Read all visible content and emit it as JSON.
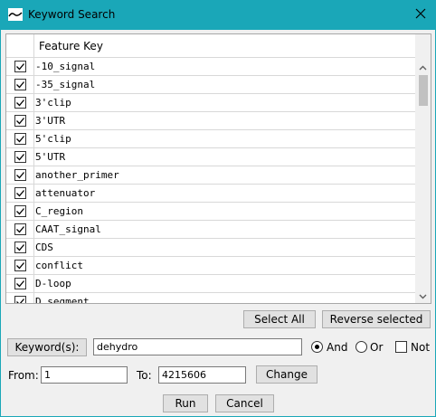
{
  "window": {
    "title": "Keyword Search",
    "accent_color": "#1aa7b8",
    "close_icon": "close-icon"
  },
  "table": {
    "column_header": "Feature Key",
    "rows": [
      {
        "key": "-10_signal",
        "checked": true
      },
      {
        "key": "-35_signal",
        "checked": true
      },
      {
        "key": "3'clip",
        "checked": true
      },
      {
        "key": "3'UTR",
        "checked": true
      },
      {
        "key": "5'clip",
        "checked": true
      },
      {
        "key": "5'UTR",
        "checked": true
      },
      {
        "key": "another_primer",
        "checked": true
      },
      {
        "key": "attenuator",
        "checked": true
      },
      {
        "key": "C_region",
        "checked": true
      },
      {
        "key": "CAAT_signal",
        "checked": true
      },
      {
        "key": "CDS",
        "checked": true
      },
      {
        "key": "conflict",
        "checked": true
      },
      {
        "key": "D-loop",
        "checked": true
      },
      {
        "key": "D_segment",
        "checked": true
      }
    ]
  },
  "actions": {
    "select_all": "Select All",
    "reverse_selected": "Reverse selected"
  },
  "search": {
    "keywords_button": "Keyword(s):",
    "keyword_value": "dehydro",
    "and_label": "And",
    "or_label": "Or",
    "not_label": "Not",
    "mode": "And",
    "not_checked": false
  },
  "range": {
    "from_label": "From:",
    "from_value": "1",
    "to_label": "To:",
    "to_value": "4215606",
    "change_button": "Change"
  },
  "footer": {
    "run_button": "Run",
    "cancel_button": "Cancel"
  }
}
